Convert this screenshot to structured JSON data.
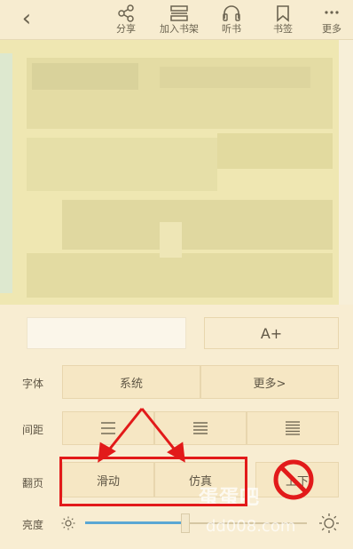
{
  "toolbar": {
    "back_icon": "chevron-left-icon",
    "share_label": "分享",
    "bookshelf_label": "加入书架",
    "listen_label": "听书",
    "bookmark_label": "书签",
    "more_label": "更多"
  },
  "panel": {
    "font_size_button": "A+",
    "font_label": "字体",
    "font_value": "系统",
    "font_more": "更多>",
    "spacing_label": "间距",
    "page_turn_label": "翻页",
    "page_turn_options": [
      "滑动",
      "仿真",
      "上下"
    ],
    "brightness_label": "亮度",
    "brightness_level": 0.45
  },
  "watermark": {
    "line1": "蛋蛋吧",
    "line2": "dd008.com"
  },
  "colors": {
    "panel_bg": "#f8edd2",
    "reading_bg": "#efe7b2",
    "accent_blue": "#5aa7d4",
    "annotation_red": "#e21a1a"
  }
}
